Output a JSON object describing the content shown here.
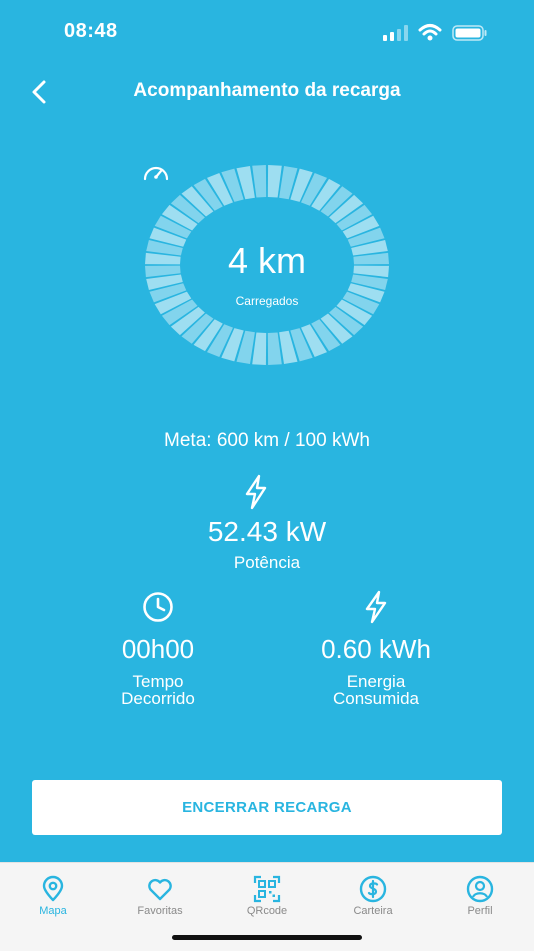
{
  "status_bar": {
    "time": "08:48"
  },
  "header": {
    "title": "Acompanhamento da recarga",
    "back_icon": "chevron-left-icon"
  },
  "gauge": {
    "value": "4 km",
    "label": "Carregados",
    "icon": "speedometer-icon",
    "segments": 48
  },
  "meta": "Meta: 600 km / 100 kWh",
  "power": {
    "icon": "lightning-icon",
    "value": "52.43 kW",
    "label": "Potência"
  },
  "stats": [
    {
      "icon": "clock-icon",
      "value": "00h00",
      "label": "Tempo Decorrido"
    },
    {
      "icon": "lightning-icon",
      "value": "0.60 kWh",
      "label": "Energia Consumida"
    }
  ],
  "end_button": {
    "label": "ENCERRAR RECARGA"
  },
  "tabs": [
    {
      "label": "Mapa",
      "icon": "map-pin-icon",
      "active": true
    },
    {
      "label": "Favoritas",
      "icon": "heart-icon",
      "active": false
    },
    {
      "label": "QRcode",
      "icon": "qrcode-icon",
      "active": false
    },
    {
      "label": "Carteira",
      "icon": "dollar-icon",
      "active": false
    },
    {
      "label": "Perfil",
      "icon": "user-icon",
      "active": false
    }
  ],
  "colors": {
    "background": "#29b5e0",
    "tab_bar": "#f5f5f5",
    "button": "#ffffff",
    "accent": "#29b5e0"
  }
}
